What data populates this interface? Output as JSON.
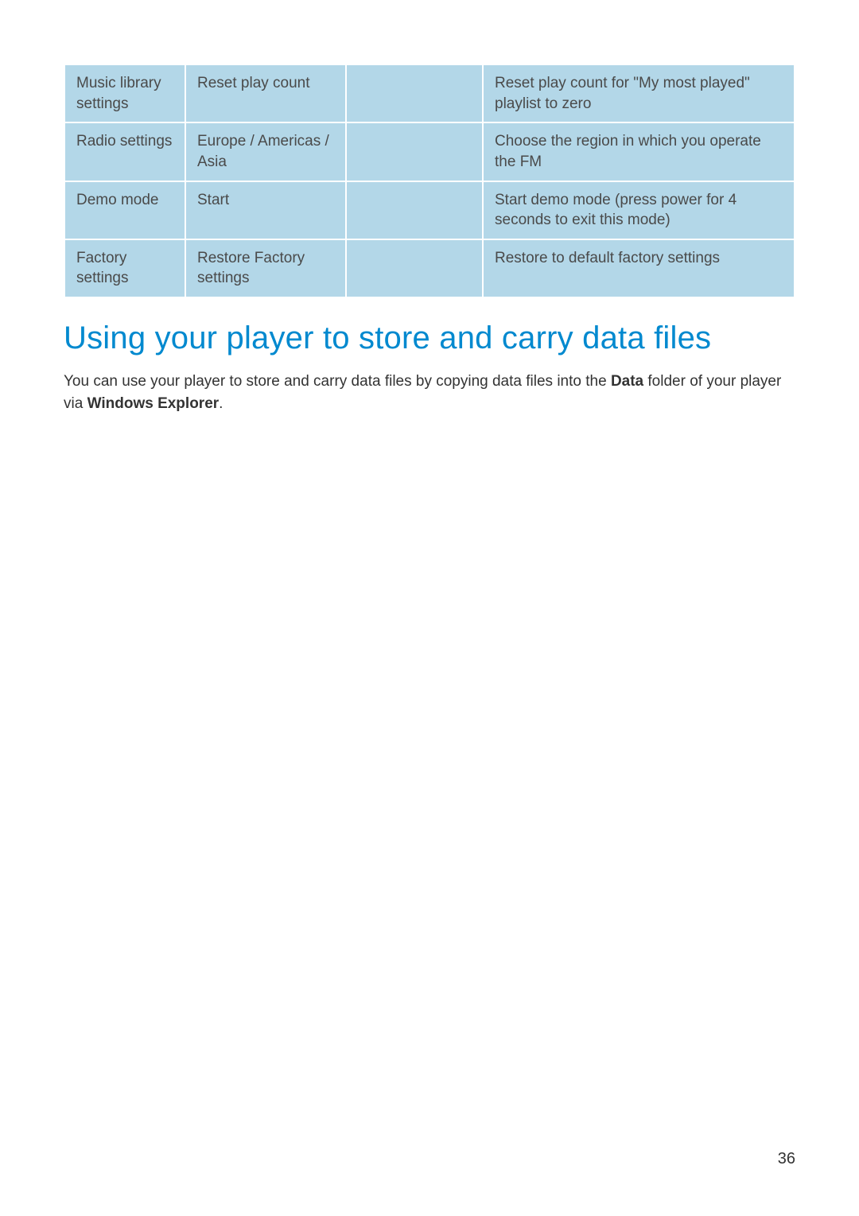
{
  "table": {
    "rows": [
      {
        "col1": "Music library settings",
        "col2": "Reset play count",
        "col3": "",
        "col4": "Reset play count for \"My most played\" playlist to zero"
      },
      {
        "col1": "Radio settings",
        "col2": "Europe / Americas / Asia",
        "col3": "",
        "col4": "Choose the region in which you operate the FM"
      },
      {
        "col1": "Demo mode",
        "col2": "Start",
        "col3": "",
        "col4": "Start demo mode (press power for 4 seconds to exit this mode)"
      },
      {
        "col1": "Factory settings",
        "col2": "Restore Factory settings",
        "col3": "",
        "col4": "Restore to default factory settings"
      }
    ]
  },
  "heading": "Using your player to store and carry data files",
  "paragraph": {
    "part1": "You can use your player to store and carry data files by copying data files into the ",
    "bold1": "Data",
    "part2": " folder of your player via ",
    "bold2": "Windows Explorer",
    "part3": "."
  },
  "page_number": "36"
}
